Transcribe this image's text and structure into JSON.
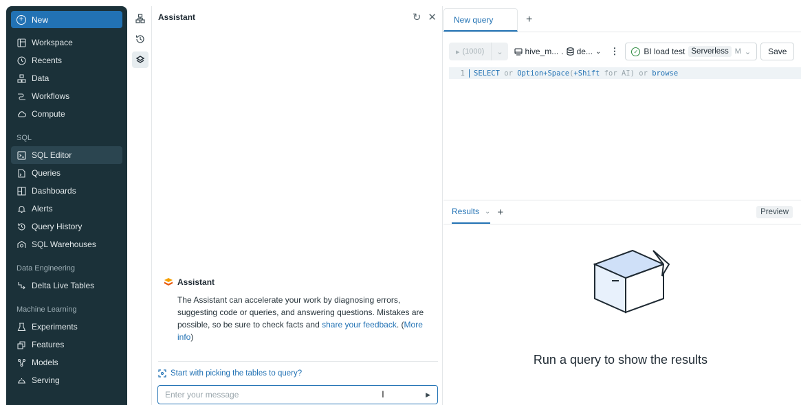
{
  "sidebar": {
    "new_label": "New",
    "items_top": [
      {
        "label": "Workspace",
        "icon": "workspace-icon"
      },
      {
        "label": "Recents",
        "icon": "clock-icon"
      },
      {
        "label": "Data",
        "icon": "data-icon"
      },
      {
        "label": "Workflows",
        "icon": "workflows-icon"
      },
      {
        "label": "Compute",
        "icon": "cloud-icon"
      }
    ],
    "sql_section": "SQL",
    "sql_items": [
      {
        "label": "SQL Editor",
        "icon": "sql-editor-icon",
        "active": true
      },
      {
        "label": "Queries",
        "icon": "queries-icon"
      },
      {
        "label": "Dashboards",
        "icon": "dashboards-icon"
      },
      {
        "label": "Alerts",
        "icon": "bell-icon"
      },
      {
        "label": "Query History",
        "icon": "history-icon"
      },
      {
        "label": "SQL Warehouses",
        "icon": "warehouse-icon"
      }
    ],
    "de_section": "Data Engineering",
    "de_items": [
      {
        "label": "Delta Live Tables",
        "icon": "pipeline-icon"
      }
    ],
    "ml_section": "Machine Learning",
    "ml_items": [
      {
        "label": "Experiments",
        "icon": "flask-icon"
      },
      {
        "label": "Features",
        "icon": "features-icon"
      },
      {
        "label": "Models",
        "icon": "models-icon"
      },
      {
        "label": "Serving",
        "icon": "serving-icon"
      }
    ]
  },
  "assistant": {
    "title": "Assistant",
    "intro_title": "Assistant",
    "intro_body_1": "The Assistant can accelerate your work by diagnosing errors, suggesting code or queries, and answering questions. Mistakes are possible, so be sure to check facts and ",
    "feedback_link": "share your feedback",
    "intro_body_2": ". (",
    "more_info_link": "More info",
    "intro_body_3": ")",
    "suggestion": "Start with picking the tables to query?",
    "input_placeholder": "Enter your message"
  },
  "editor": {
    "tab_label": "New query",
    "run_label": "(1000)",
    "catalog": "hive_m...",
    "schema": "de...",
    "warehouse_name": "BI load test",
    "warehouse_type": "Serverless",
    "warehouse_size": "M",
    "save_label": "Save",
    "line_number": "1",
    "code_select": "SELECT",
    "code_or1": " or ",
    "code_option": "Option+Space",
    "code_shift_open": "(",
    "code_shift": "+Shift",
    "code_for_ai": " for AI)",
    "code_or2": " or ",
    "code_browse": "browse",
    "results_tab": "Results",
    "preview_label": "Preview",
    "empty_message": "Run a query to show the results"
  },
  "colors": {
    "sidebar_bg": "#1b3139",
    "accent": "#2272b4"
  }
}
